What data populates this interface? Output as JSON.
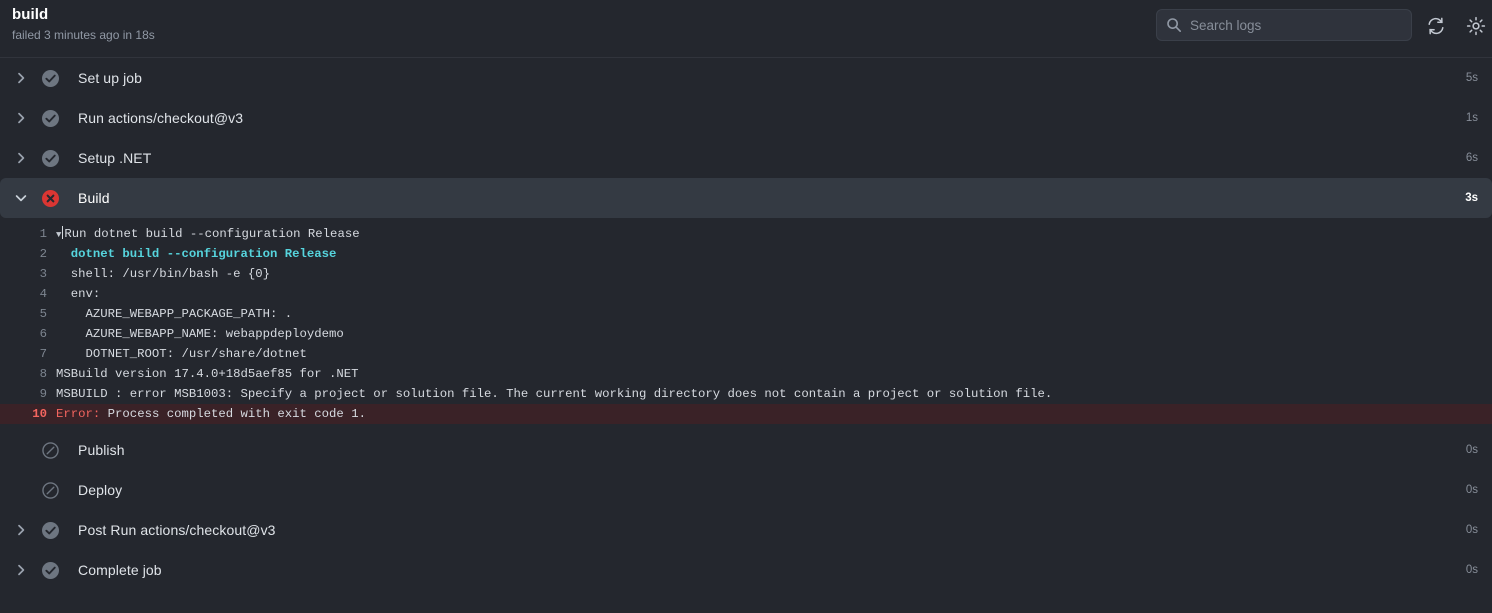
{
  "header": {
    "job_title": "build",
    "job_status_text": "failed 3 minutes ago in 18s",
    "search": {
      "placeholder": "Search logs",
      "value": "",
      "icon": "search-icon"
    },
    "refresh_icon": "refresh-icon",
    "settings_icon": "gear-icon"
  },
  "colors": {
    "page_background": "#24272e",
    "active_row_background": "#343a43",
    "success_icon": "#6e7681",
    "failure_icon": "#da3633",
    "skipped_icon": "#6e7681",
    "error_line_background": "#3a2227",
    "error_text": "#f4655f",
    "command_text": "#56d4dd",
    "log_text": "#d6dae0",
    "muted_text": "#878e99"
  },
  "steps": [
    {
      "label": "Set up job",
      "status": "success",
      "duration": "5s",
      "expandable": true,
      "expanded": false
    },
    {
      "label": "Run actions/checkout@v3",
      "status": "success",
      "duration": "1s",
      "expandable": true,
      "expanded": false
    },
    {
      "label": "Setup .NET",
      "status": "success",
      "duration": "6s",
      "expandable": true,
      "expanded": false
    },
    {
      "label": "Build",
      "status": "failure",
      "duration": "3s",
      "expandable": true,
      "expanded": true
    },
    {
      "label": "Publish",
      "status": "skipped",
      "duration": "0s",
      "expandable": false,
      "expanded": false
    },
    {
      "label": "Deploy",
      "status": "skipped",
      "duration": "0s",
      "expandable": false,
      "expanded": false
    },
    {
      "label": "Post Run actions/checkout@v3",
      "status": "success",
      "duration": "0s",
      "expandable": true,
      "expanded": false
    },
    {
      "label": "Complete job",
      "status": "success",
      "duration": "0s",
      "expandable": true,
      "expanded": false
    }
  ],
  "log": {
    "lines": [
      {
        "number": "1",
        "text": "Run dotnet build --configuration Release",
        "style": "group-header"
      },
      {
        "number": "2",
        "text": "  dotnet build --configuration Release",
        "style": "command"
      },
      {
        "number": "3",
        "text": "  shell: /usr/bin/bash -e {0}",
        "style": "plain"
      },
      {
        "number": "4",
        "text": "  env:",
        "style": "plain"
      },
      {
        "number": "5",
        "text": "    AZURE_WEBAPP_PACKAGE_PATH: .",
        "style": "plain"
      },
      {
        "number": "6",
        "text": "    AZURE_WEBAPP_NAME: webappdeploydemo",
        "style": "plain"
      },
      {
        "number": "7",
        "text": "    DOTNET_ROOT: /usr/share/dotnet",
        "style": "plain"
      },
      {
        "number": "8",
        "text": "MSBuild version 17.4.0+18d5aef85 for .NET",
        "style": "plain"
      },
      {
        "number": "9",
        "text": "MSBUILD : error MSB1003: Specify a project or solution file. The current working directory does not contain a project or solution file.",
        "style": "plain"
      },
      {
        "number": "10",
        "text": "Process completed with exit code 1.",
        "style": "error",
        "error_prefix": "Error:"
      }
    ]
  }
}
